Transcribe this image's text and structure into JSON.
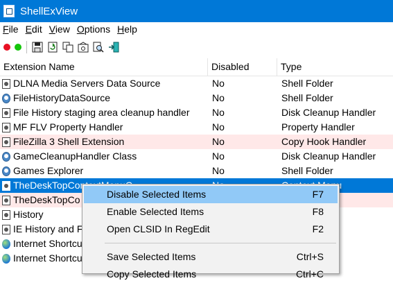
{
  "window": {
    "title": "ShellExView",
    "icon": "app-icon"
  },
  "menu": [
    {
      "label_u": "F",
      "label_rest": "ile"
    },
    {
      "label_u": "E",
      "label_rest": "dit"
    },
    {
      "label_u": "V",
      "label_rest": "iew"
    },
    {
      "label_u": "O",
      "label_rest": "ptions"
    },
    {
      "label_u": "H",
      "label_rest": "elp"
    }
  ],
  "toolbar": {
    "icons": [
      "disable-red-dot-icon",
      "enable-green-dot-icon",
      "save-icon",
      "refresh-icon",
      "copy-icon",
      "properties-icon",
      "find-icon",
      "exit-icon"
    ],
    "colors": {
      "red": "#e81123",
      "green": "#16c60c"
    }
  },
  "columns": {
    "c1": "Extension Name",
    "c2": "Disabled",
    "c3": "Type"
  },
  "rows": [
    {
      "name": "DLNA Media Servers Data Source",
      "disabled": "No",
      "type": "Shell Folder",
      "icon": "document-icon"
    },
    {
      "name": "FileHistoryDataSource",
      "disabled": "No",
      "type": "Shell Folder",
      "icon": "settings-icon"
    },
    {
      "name": "File History staging area cleanup handler",
      "disabled": "No",
      "type": "Disk Cleanup Handler",
      "icon": "document-icon"
    },
    {
      "name": "MF FLV Property Handler",
      "disabled": "No",
      "type": "Property Handler",
      "icon": "document-icon"
    },
    {
      "name": "FileZilla 3 Shell Extension",
      "disabled": "No",
      "type": "Copy Hook Handler",
      "icon": "document-icon"
    },
    {
      "name": "GameCleanupHandler Class",
      "disabled": "No",
      "type": "Disk Cleanup Handler",
      "icon": "settings-icon"
    },
    {
      "name": "Games Explorer",
      "disabled": "No",
      "type": "Shell Folder",
      "icon": "settings-icon"
    },
    {
      "name": "TheDeskTopContextMenuC",
      "disabled": "No",
      "type": "Context Menu",
      "icon": "document-icon"
    },
    {
      "name": "TheDeskTopCo",
      "disabled": "",
      "type": "et",
      "icon": "document-icon"
    },
    {
      "name": "History",
      "disabled": "",
      "type": "",
      "icon": "document-icon"
    },
    {
      "name": "IE History and F",
      "disabled": "",
      "type": "",
      "icon": "document-icon"
    },
    {
      "name": "Internet Shortcu",
      "disabled": "",
      "type": "",
      "icon": "globe-icon"
    },
    {
      "name": "Internet Shortcu",
      "disabled": "",
      "type": "",
      "icon": "globe-icon"
    }
  ],
  "row_colors": {
    "highlight_pink": "#ffe8e8",
    "selected": "#0078d7"
  },
  "context_menu": {
    "items": [
      {
        "label": "Disable Selected Items",
        "shortcut": "F7"
      },
      {
        "label": "Enable Selected Items",
        "shortcut": "F8"
      },
      {
        "label": "Open CLSID In RegEdit",
        "shortcut": "F2"
      },
      {
        "label": "Save Selected Items",
        "shortcut": "Ctrl+S"
      },
      {
        "label": "Copy Selected Items",
        "shortcut": "Ctrl+C"
      }
    ],
    "hover_color": "#91c9f7"
  }
}
